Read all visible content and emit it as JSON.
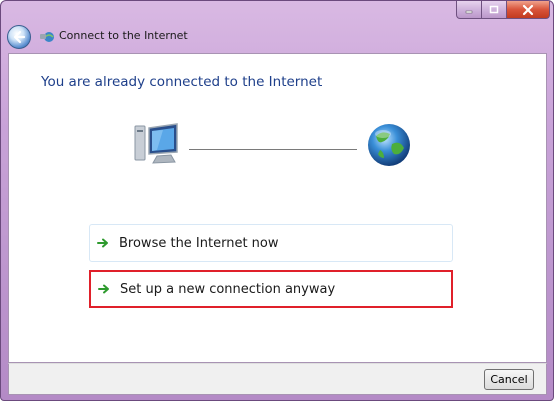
{
  "window": {
    "title": "Connect to the Internet",
    "controls": [
      "minimize",
      "maximize",
      "close"
    ]
  },
  "main": {
    "headline": "You are already connected to the Internet",
    "status_icons": [
      "computer-icon",
      "globe-icon"
    ],
    "options": [
      {
        "label": "Browse the Internet now",
        "icon": "green-arrow-icon",
        "highlighted": false
      },
      {
        "label": "Set up a new connection anyway",
        "icon": "green-arrow-icon",
        "highlighted": true
      }
    ]
  },
  "footer": {
    "cancel_label": "Cancel"
  },
  "colors": {
    "frame": "#c9a3d8",
    "headline": "#1e3f8a",
    "highlight_border": "#e0202a",
    "arrow": "#2e9a2e"
  }
}
